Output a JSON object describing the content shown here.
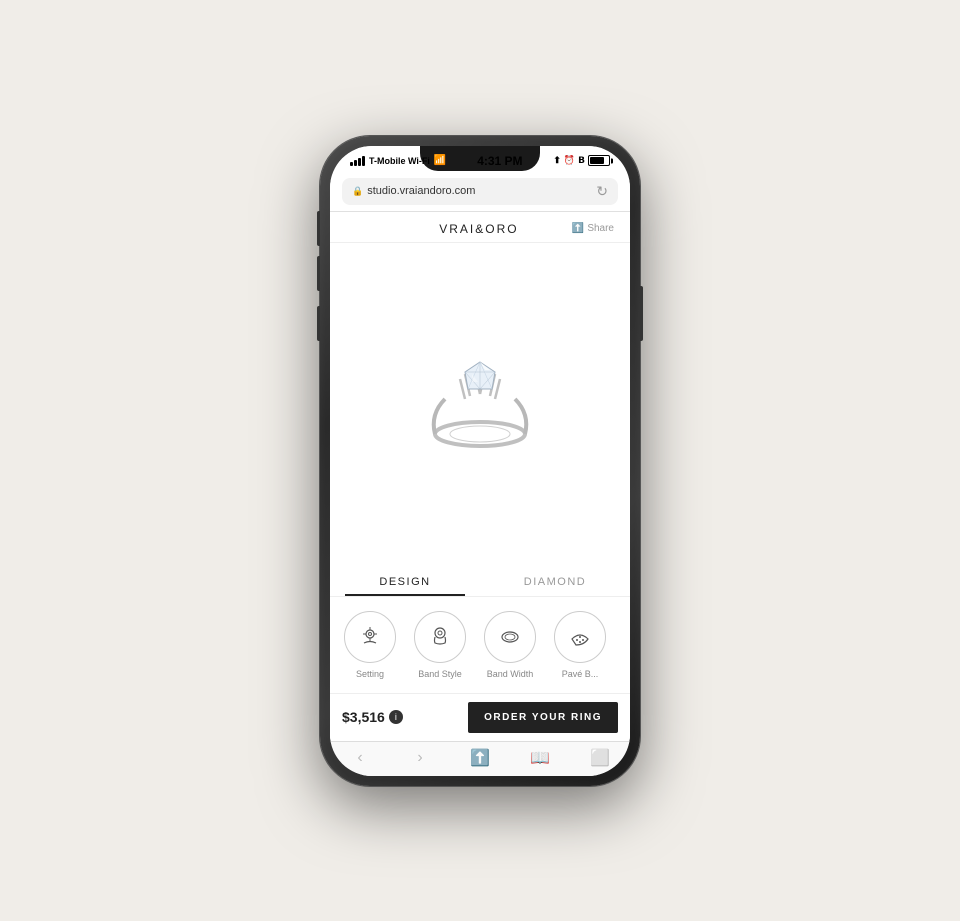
{
  "phone": {
    "status_bar": {
      "carrier": "T-Mobile Wi-Fi",
      "time": "4:31 PM",
      "location_icon": "📍",
      "bluetooth_icon": "B",
      "battery_level": 75
    },
    "url_bar": {
      "url": "studio.vraiandoro.com",
      "lock_symbol": "🔒",
      "refresh_symbol": "↻"
    },
    "header": {
      "brand": "VRAI&ORO",
      "share_label": "Share"
    },
    "tabs": [
      {
        "id": "design",
        "label": "DESIGN",
        "active": true
      },
      {
        "id": "diamond",
        "label": "DIAMOND",
        "active": false
      }
    ],
    "design_options": [
      {
        "id": "setting",
        "label": "Setting"
      },
      {
        "id": "band-style",
        "label": "Band Style"
      },
      {
        "id": "band-width",
        "label": "Band Width"
      },
      {
        "id": "pave",
        "label": "Pavé B..."
      }
    ],
    "bottom": {
      "price": "$3,516",
      "info": "i",
      "order_button": "ORDER YOUR RING"
    }
  }
}
